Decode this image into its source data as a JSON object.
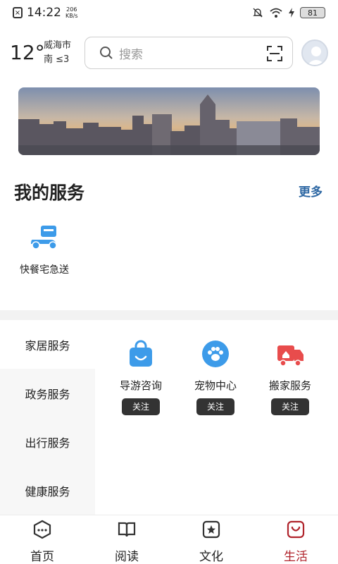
{
  "status_bar": {
    "time": "14:22",
    "speed_value": "206",
    "speed_unit": "KB/s",
    "battery": "81"
  },
  "header": {
    "temperature": "12°",
    "city": "威海市",
    "wind": "南 ≤3",
    "search_placeholder": "搜索"
  },
  "my_services": {
    "title": "我的服务",
    "more_label": "更多",
    "items": [
      {
        "label": "快餐宅急送",
        "icon": "delivery-scooter-icon"
      }
    ]
  },
  "categories": [
    {
      "label": "家居服务",
      "active": true
    },
    {
      "label": "政务服务",
      "active": false
    },
    {
      "label": "出行服务",
      "active": false
    },
    {
      "label": "健康服务",
      "active": false
    }
  ],
  "category_items": [
    {
      "name": "导游咨询",
      "icon": "shopping-bag-icon",
      "follow_label": "关注",
      "color": "#3d9be9"
    },
    {
      "name": "宠物中心",
      "icon": "paw-icon",
      "follow_label": "关注",
      "color": "#3d9be9"
    },
    {
      "name": "搬家服务",
      "icon": "moving-truck-icon",
      "follow_label": "关注",
      "color": "#e84c4c"
    }
  ],
  "tabbar": [
    {
      "label": "首页",
      "icon": "home-hexagon-icon",
      "active": false
    },
    {
      "label": "阅读",
      "icon": "book-icon",
      "active": false
    },
    {
      "label": "文化",
      "icon": "star-frame-icon",
      "active": false
    },
    {
      "label": "生活",
      "icon": "smile-bag-icon",
      "active": true
    }
  ],
  "colors": {
    "accent_blue": "#2d67a3",
    "icon_blue": "#3d9be9",
    "icon_red": "#e84c4c",
    "tab_active": "#b0242c",
    "follow_button": "#333333"
  }
}
